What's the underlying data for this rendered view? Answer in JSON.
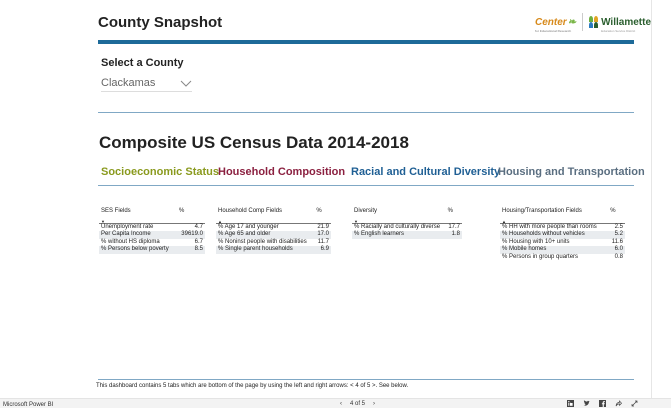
{
  "report": {
    "title": "County Snapshot",
    "logo_center_text": "Center",
    "logo_center_sub": "for Educational Research",
    "logo_willamette_text": "Willamette",
    "logo_willamette_sub": "Education Service District"
  },
  "filter": {
    "label": "Select a County",
    "selected": "Clackamas"
  },
  "section_title": "Composite US Census Data 2014-2018",
  "categories": [
    {
      "label": "Socioeconomic Status",
      "color": "#8a9a1e"
    },
    {
      "label": "Household Composition",
      "color": "#8b2040"
    },
    {
      "label": "Racial and Cultural Diversity",
      "color": "#1f5f94"
    },
    {
      "label": "Housing and Transportation",
      "color": "#5a6e80"
    }
  ],
  "tables": {
    "ses": {
      "headers": [
        "SES Fields",
        "%"
      ],
      "rows": [
        [
          "Unemployment rate",
          "4.7"
        ],
        [
          "Per Capita Income",
          "39619.0"
        ],
        [
          "% without HS diploma",
          "6.7"
        ],
        [
          "% Persons below poverty",
          "8.5"
        ]
      ]
    },
    "household": {
      "headers": [
        "Household Comp Fields",
        "%"
      ],
      "rows": [
        [
          "% Age 17 and younger",
          "21.9"
        ],
        [
          "% Age 65 and older",
          "17.0"
        ],
        [
          "% Noninst people with disabilities",
          "11.7"
        ],
        [
          "% Single parent households",
          "6.9"
        ]
      ]
    },
    "diversity": {
      "headers": [
        "Diversity",
        "%"
      ],
      "rows": [
        [
          "% Racially and culturally diverse",
          "17.7"
        ],
        [
          "% English learners",
          "1.8"
        ]
      ]
    },
    "housing": {
      "headers": [
        "Housing/Transportation Fields",
        "%"
      ],
      "rows": [
        [
          "% HH with more people than rooms",
          "2.5"
        ],
        [
          "% Households without vehicles",
          "5.2"
        ],
        [
          "% Housing with 10+ units",
          "11.6"
        ],
        [
          "% Mobile homes",
          "6.0"
        ],
        [
          "% Persons in group quarters",
          "0.8"
        ]
      ]
    }
  },
  "footnote": "This dashboard contains 5 tabs which are bottom of the page by using the left and right arrows: < 4 of 5 >. See below.",
  "status_bar": {
    "brand": "Microsoft Power BI",
    "page_prev": "‹",
    "page_indicator": "4 of 5",
    "page_next": "›"
  }
}
